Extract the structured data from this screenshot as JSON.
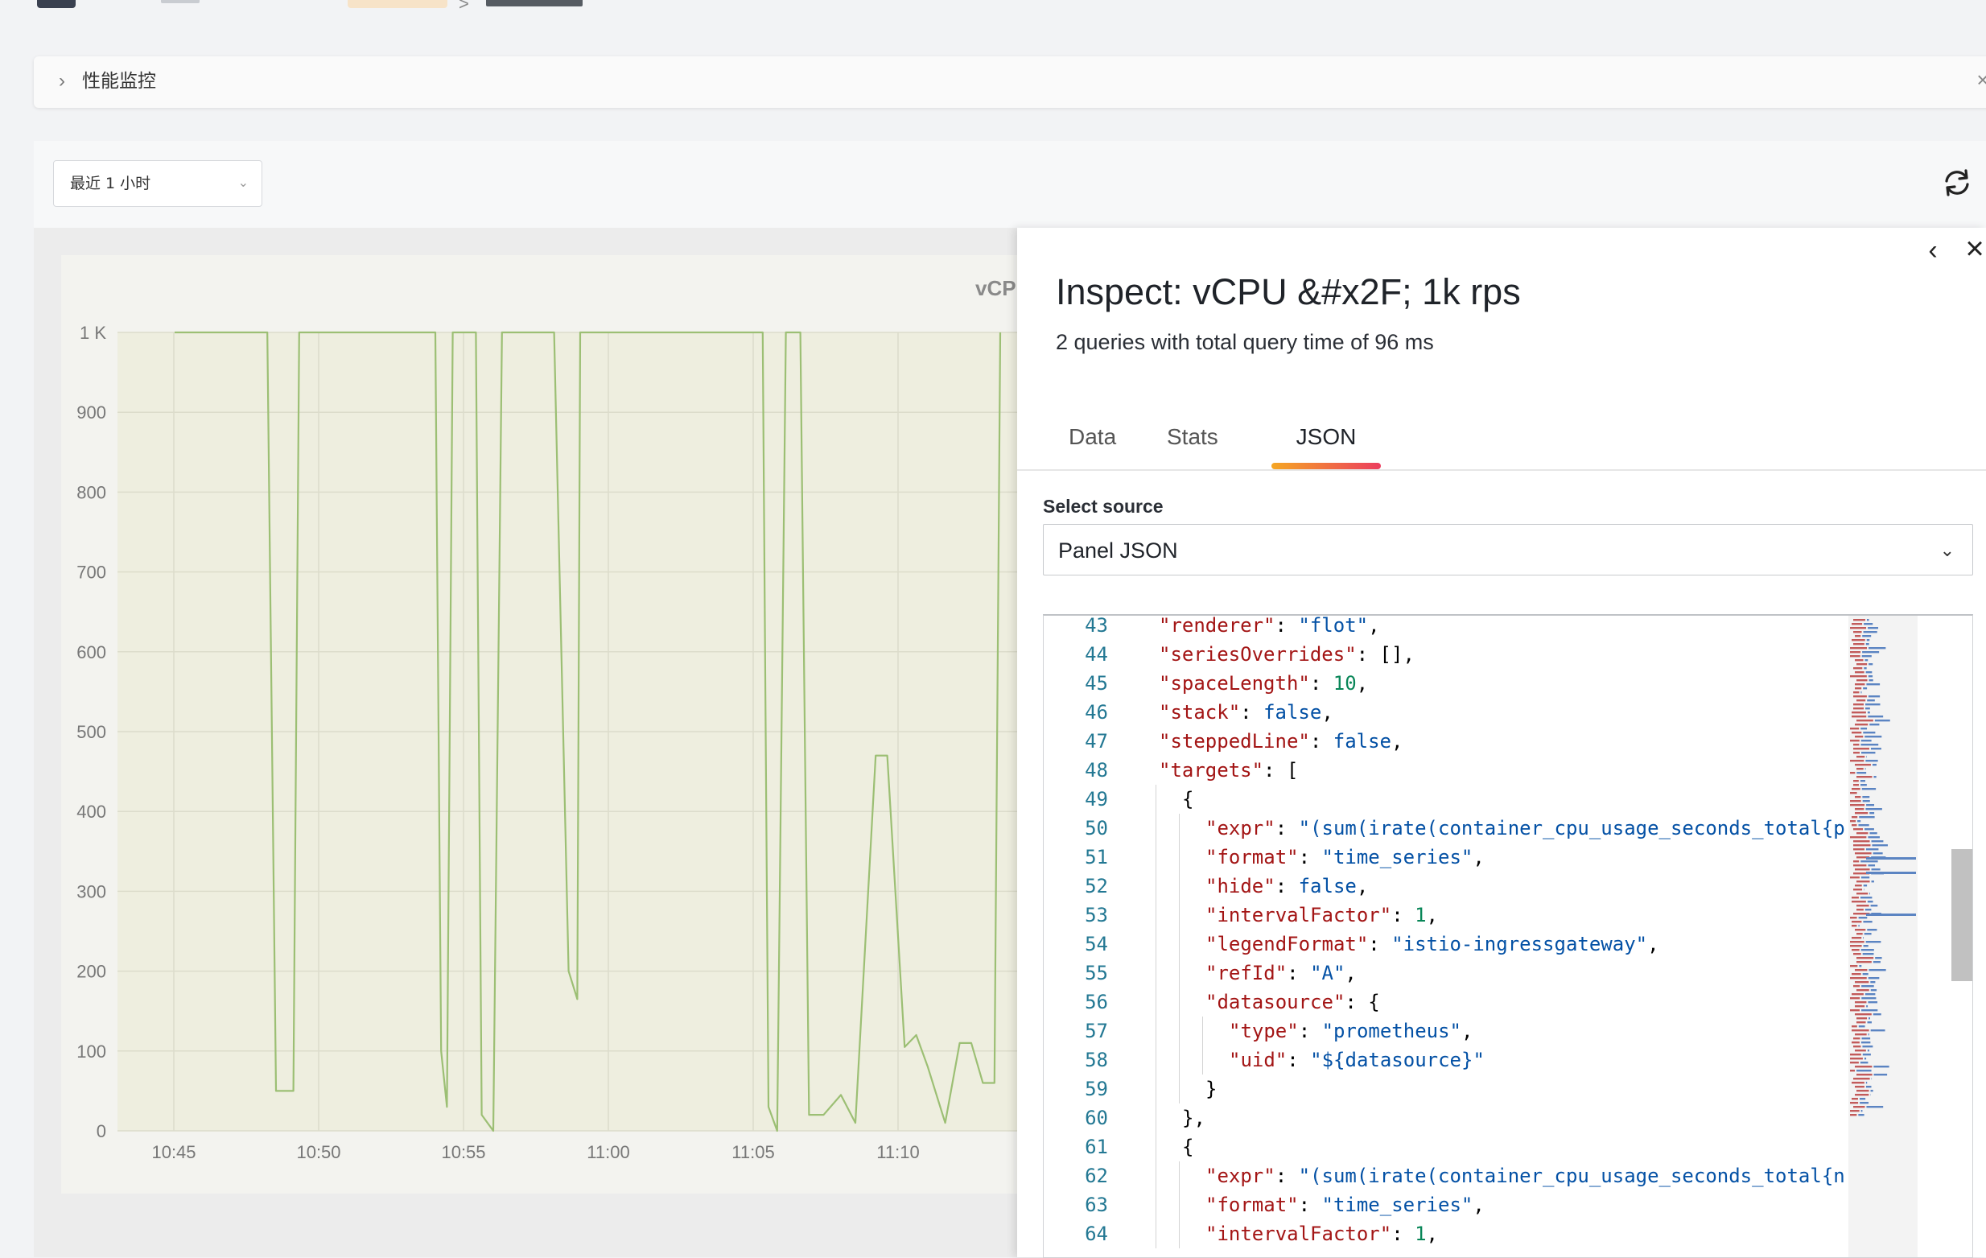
{
  "header": {
    "breadcrumb_sep": ">"
  },
  "collapse": {
    "title": "性能监控",
    "chevron": "›",
    "close": "×"
  },
  "toolbar": {
    "time_range": "最近 1 小时",
    "dropdown_icon": "chevron-down-icon",
    "refresh_icon": "refresh-icon"
  },
  "chart_data": {
    "type": "line",
    "title": "vCPU /",
    "x": [
      "10:45",
      "10:50",
      "10:55",
      "11:00",
      "11:05",
      "11:10"
    ],
    "y_ticks": [
      "1 K",
      "900",
      "800",
      "700",
      "600",
      "500",
      "400",
      "300",
      "200",
      "100",
      "0"
    ],
    "ylim": [
      0,
      1000
    ],
    "series": [
      {
        "points": [
          [
            0,
            1000
          ],
          [
            3.2,
            1000
          ],
          [
            3.5,
            50
          ],
          [
            4.1,
            50
          ],
          [
            4.3,
            1000
          ],
          [
            9,
            1000
          ],
          [
            9.2,
            100
          ],
          [
            9.4,
            30
          ],
          [
            9.6,
            1000
          ],
          [
            10.4,
            1000
          ],
          [
            10.6,
            20
          ],
          [
            11.0,
            0
          ],
          [
            11.3,
            1000
          ],
          [
            13.1,
            1000
          ],
          [
            13.6,
            200
          ],
          [
            13.9,
            165
          ],
          [
            14.0,
            1000
          ],
          [
            20.3,
            1000
          ],
          [
            20.5,
            30
          ],
          [
            20.8,
            0
          ],
          [
            21.1,
            1000
          ],
          [
            21.6,
            1000
          ],
          [
            21.9,
            20
          ],
          [
            22.4,
            20
          ],
          [
            23.0,
            45
          ],
          [
            23.5,
            10
          ],
          [
            24.2,
            470
          ],
          [
            24.6,
            470
          ],
          [
            25.2,
            105
          ],
          [
            25.6,
            120
          ],
          [
            26.0,
            80
          ],
          [
            26.6,
            10
          ],
          [
            27.1,
            110
          ],
          [
            27.5,
            110
          ],
          [
            27.9,
            60
          ],
          [
            28.3,
            60
          ],
          [
            28.5,
            1000
          ]
        ]
      }
    ],
    "grid": true,
    "color": "#9cbf74"
  },
  "drawer": {
    "title": "Inspect: vCPU &#x2F; 1k rps",
    "subtitle": "2 queries with total query time of 96 ms",
    "back_icon": "‹",
    "close_icon": "×",
    "tabs": [
      {
        "label": "Data"
      },
      {
        "label": "Stats"
      },
      {
        "label": "JSON"
      }
    ],
    "active_tab": "JSON",
    "select_label": "Select source",
    "select_value": "Panel JSON",
    "select_arrow": "⌄"
  },
  "editor": {
    "lines": [
      {
        "no": "43",
        "indent": 1,
        "tokens": [
          [
            "k",
            "\"renderer\""
          ],
          [
            "p",
            ": "
          ],
          [
            "s",
            "\"flot\""
          ],
          [
            "p",
            ","
          ]
        ]
      },
      {
        "no": "44",
        "indent": 1,
        "tokens": [
          [
            "k",
            "\"seriesOverrides\""
          ],
          [
            "p",
            ": [],"
          ]
        ]
      },
      {
        "no": "45",
        "indent": 1,
        "tokens": [
          [
            "k",
            "\"spaceLength\""
          ],
          [
            "p",
            ": "
          ],
          [
            "n",
            "10"
          ],
          [
            "p",
            ","
          ]
        ]
      },
      {
        "no": "46",
        "indent": 1,
        "tokens": [
          [
            "k",
            "\"stack\""
          ],
          [
            "p",
            ": "
          ],
          [
            "b",
            "false"
          ],
          [
            "p",
            ","
          ]
        ]
      },
      {
        "no": "47",
        "indent": 1,
        "tokens": [
          [
            "k",
            "\"steppedLine\""
          ],
          [
            "p",
            ": "
          ],
          [
            "b",
            "false"
          ],
          [
            "p",
            ","
          ]
        ]
      },
      {
        "no": "48",
        "indent": 1,
        "tokens": [
          [
            "k",
            "\"targets\""
          ],
          [
            "p",
            ": ["
          ]
        ]
      },
      {
        "no": "49",
        "indent": 2,
        "tokens": [
          [
            "p",
            "{"
          ]
        ]
      },
      {
        "no": "50",
        "indent": 3,
        "tokens": [
          [
            "k",
            "\"expr\""
          ],
          [
            "p",
            ": "
          ],
          [
            "s",
            "\"(sum(irate(container_cpu_usage_seconds_total{p"
          ]
        ]
      },
      {
        "no": "51",
        "indent": 3,
        "tokens": [
          [
            "k",
            "\"format\""
          ],
          [
            "p",
            ": "
          ],
          [
            "s",
            "\"time_series\""
          ],
          [
            "p",
            ","
          ]
        ]
      },
      {
        "no": "52",
        "indent": 3,
        "tokens": [
          [
            "k",
            "\"hide\""
          ],
          [
            "p",
            ": "
          ],
          [
            "b",
            "false"
          ],
          [
            "p",
            ","
          ]
        ]
      },
      {
        "no": "53",
        "indent": 3,
        "tokens": [
          [
            "k",
            "\"intervalFactor\""
          ],
          [
            "p",
            ": "
          ],
          [
            "n",
            "1"
          ],
          [
            "p",
            ","
          ]
        ]
      },
      {
        "no": "54",
        "indent": 3,
        "tokens": [
          [
            "k",
            "\"legendFormat\""
          ],
          [
            "p",
            ": "
          ],
          [
            "s",
            "\"istio-ingressgateway\""
          ],
          [
            "p",
            ","
          ]
        ]
      },
      {
        "no": "55",
        "indent": 3,
        "tokens": [
          [
            "k",
            "\"refId\""
          ],
          [
            "p",
            ": "
          ],
          [
            "s",
            "\"A\""
          ],
          [
            "p",
            ","
          ]
        ]
      },
      {
        "no": "56",
        "indent": 3,
        "tokens": [
          [
            "k",
            "\"datasource\""
          ],
          [
            "p",
            ": {"
          ]
        ]
      },
      {
        "no": "57",
        "indent": 4,
        "tokens": [
          [
            "k",
            "\"type\""
          ],
          [
            "p",
            ": "
          ],
          [
            "s",
            "\"prometheus\""
          ],
          [
            "p",
            ","
          ]
        ]
      },
      {
        "no": "58",
        "indent": 4,
        "tokens": [
          [
            "k",
            "\"uid\""
          ],
          [
            "p",
            ": "
          ],
          [
            "s",
            "\"${datasource}\""
          ]
        ]
      },
      {
        "no": "59",
        "indent": 3,
        "tokens": [
          [
            "p",
            "}"
          ]
        ]
      },
      {
        "no": "60",
        "indent": 2,
        "tokens": [
          [
            "p",
            "},"
          ]
        ]
      },
      {
        "no": "61",
        "indent": 2,
        "tokens": [
          [
            "p",
            "{"
          ]
        ]
      },
      {
        "no": "62",
        "indent": 3,
        "tokens": [
          [
            "k",
            "\"expr\""
          ],
          [
            "p",
            ": "
          ],
          [
            "s",
            "\"(sum(irate(container_cpu_usage_seconds_total{n"
          ]
        ]
      },
      {
        "no": "63",
        "indent": 3,
        "tokens": [
          [
            "k",
            "\"format\""
          ],
          [
            "p",
            ": "
          ],
          [
            "s",
            "\"time_series\""
          ],
          [
            "p",
            ","
          ]
        ]
      },
      {
        "no": "64",
        "indent": 3,
        "tokens": [
          [
            "k",
            "\"intervalFactor\""
          ],
          [
            "p",
            ": "
          ],
          [
            "n",
            "1"
          ],
          [
            "p",
            ","
          ]
        ]
      }
    ]
  }
}
